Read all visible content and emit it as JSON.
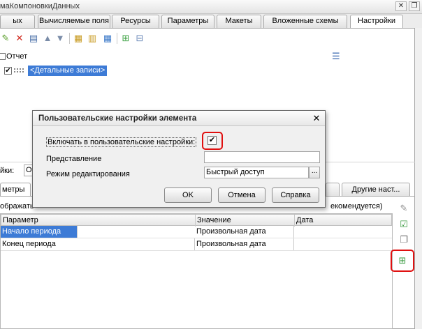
{
  "window": {
    "title": "маКомпоновкиДанных"
  },
  "tabs": [
    {
      "label": "ых"
    },
    {
      "label": "Вычисляемые поля"
    },
    {
      "label": "Ресурсы"
    },
    {
      "label": "Параметры"
    },
    {
      "label": "Макеты"
    },
    {
      "label": "Вложенные схемы"
    },
    {
      "label": "Настройки"
    }
  ],
  "tree": {
    "root_label": "Отчет",
    "child_label": "<Детальные записи>"
  },
  "lower": {
    "field_label": "йки:",
    "field_value": "От",
    "subtab_left": "метры",
    "subtab_right": "Другие наст...",
    "hint_left": "ображать",
    "hint_right": "екомендуется)",
    "columns": [
      "Параметр",
      "Значение",
      "Дата"
    ],
    "rows": [
      {
        "param": "Начало периода",
        "value": "Произвольная дата",
        "date": ""
      },
      {
        "param": "Конец периода",
        "value": "Произвольная дата",
        "date": ""
      }
    ]
  },
  "dialog": {
    "title": "Пользовательские настройки элемента",
    "close": "✕",
    "include_label": "Включать в пользовательские настройки:",
    "include_checked": true,
    "presentation_label": "Представление",
    "presentation_value": "",
    "mode_label": "Режим редактирования",
    "mode_value": "Быстрый доступ",
    "ellipsis": "...",
    "ok": "OK",
    "cancel": "Отмена",
    "help": "Справка"
  },
  "colors": {
    "selection": "#3d7bd6",
    "highlight": "#e01010"
  }
}
